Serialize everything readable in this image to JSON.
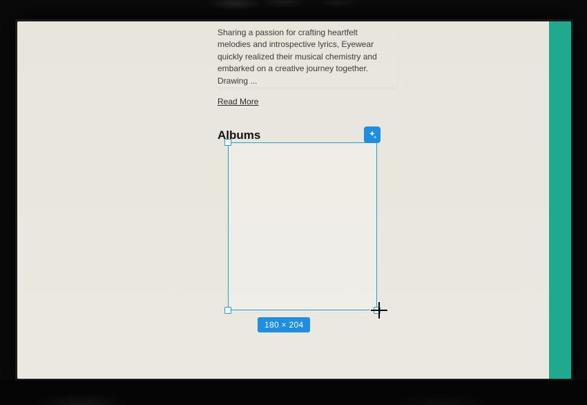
{
  "bio": {
    "text": "Sharing a passion for crafting heartfelt melodies and introspective lyrics, Eyewear quickly realized their musical chemistry and embarked on a creative journey together. Drawing ...",
    "read_more_label": "Read More"
  },
  "section": {
    "albums_heading": "Albums"
  },
  "selection": {
    "dimensions_label": "180 × 204"
  },
  "colors": {
    "accent_teal": "#1fa98f",
    "selection_blue": "#1f9ed8",
    "badge_blue": "#1f8de0"
  }
}
